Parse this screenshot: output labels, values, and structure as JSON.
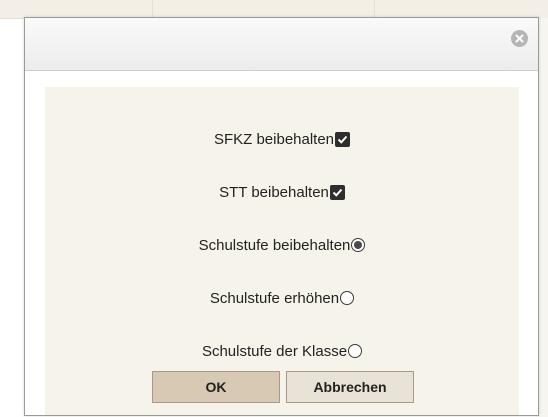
{
  "dialog": {
    "options": [
      {
        "label": "SFKZ beibehalten",
        "control": "checkbox",
        "checked": true
      },
      {
        "label": "STT beibehalten",
        "control": "checkbox",
        "checked": true
      },
      {
        "label": "Schulstufe beibehalten",
        "control": "radio",
        "checked": true
      },
      {
        "label": "Schulstufe erhöhen",
        "control": "radio",
        "checked": false
      },
      {
        "label": "Schulstufe der Klasse",
        "control": "radio",
        "checked": false
      }
    ],
    "ok_label": "OK",
    "cancel_label": "Abbrechen",
    "close_icon": "close-icon"
  },
  "colors": {
    "content_bg": "#f6f4ea",
    "ok_button": "#d7c9b4",
    "cancel_button": "#e8e2d7"
  }
}
